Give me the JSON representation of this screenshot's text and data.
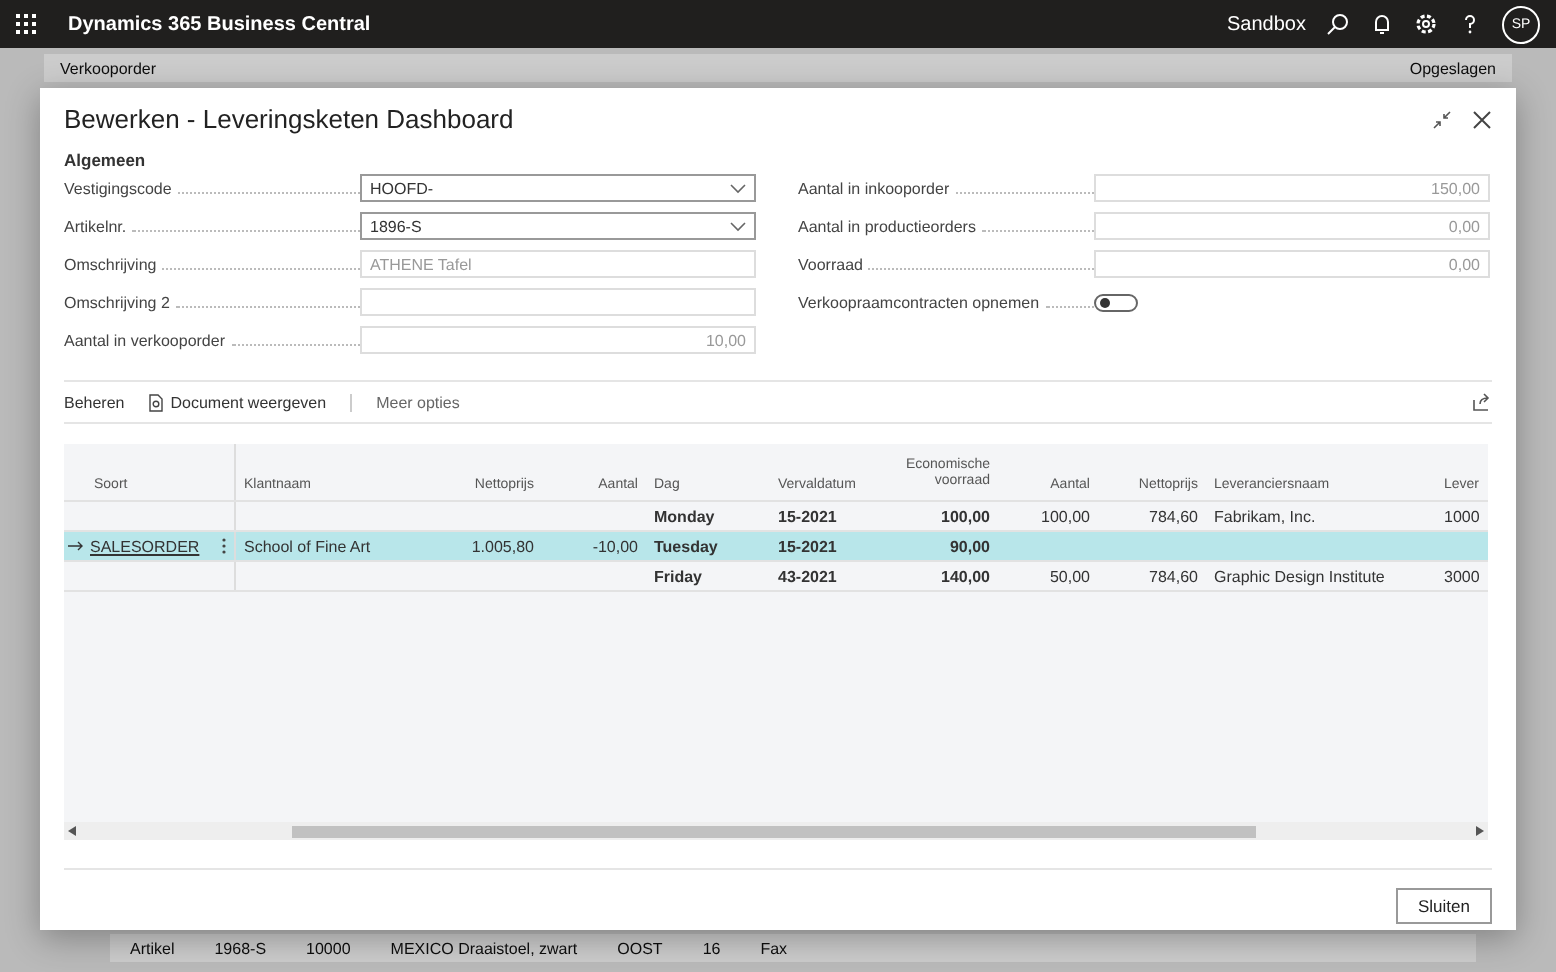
{
  "top_bar": {
    "app_title": "Dynamics 365 Business Central",
    "environment": "Sandbox",
    "avatar": "SP"
  },
  "background_page": {
    "title": "Verkooporder",
    "save_status": "Opgeslagen",
    "rows": [
      [
        "Artikel",
        "1968-S",
        "10000",
        "MEXICO Draaistoel, zwart",
        "OOST",
        "16",
        "Fax"
      ]
    ]
  },
  "dialog": {
    "title": "Bewerken - Leveringsketen Dashboard",
    "section": "Algemeen",
    "left_fields": [
      {
        "label": "Vestigingscode",
        "kind": "dropdown",
        "value": "HOOFD-",
        "disabled": false
      },
      {
        "label": "Artikelnr.",
        "kind": "dropdown",
        "value": "1896-S",
        "disabled": false
      },
      {
        "label": "Omschrijving",
        "kind": "text",
        "value": "ATHENE Tafel",
        "disabled": true
      },
      {
        "label": "Omschrijving 2",
        "kind": "text",
        "disabled": true
      },
      {
        "label": "Aantal in verkooporder",
        "kind": "number",
        "value": "10,00",
        "disabled": true
      }
    ],
    "right_fields": [
      {
        "label": "Aantal in inkooporder",
        "kind": "number",
        "value": "150,00",
        "disabled": true
      },
      {
        "label": "Aantal in productieorders",
        "kind": "number",
        "value": "0,00",
        "disabled": true
      },
      {
        "label": "Voorraad",
        "kind": "number",
        "value": "0,00",
        "disabled": true
      },
      {
        "label": "Verkoopraamcontracten opnemen",
        "kind": "toggle",
        "on": false
      }
    ],
    "actions": [
      {
        "label": "Beheren",
        "kind": "plain"
      },
      {
        "label": "Document weergeven",
        "kind": "icon"
      },
      {
        "label": "Meer opties",
        "kind": "more"
      }
    ],
    "table": {
      "columns": [
        "Soort",
        "Klantnaam",
        "Nettoprijs",
        "Aantal",
        "Dag",
        "Vervaldatum",
        "Economische voorraad",
        "Aantal",
        "Nettoprijs",
        "Leveranciersnaam",
        "Lever"
      ],
      "rows": [
        {
          "selected": false,
          "cells": [
            null,
            null,
            null,
            null,
            "Monday",
            "15-2021",
            "100,00",
            "100,00",
            "784,60",
            "Fabrikam, Inc.",
            "1000"
          ]
        },
        {
          "selected": true,
          "cells": [
            "SALESORDER",
            "School of Fine Art",
            "1.005,80",
            "-10,00",
            "Tuesday",
            "15-2021",
            "90,00",
            null,
            null,
            null,
            null
          ]
        },
        {
          "selected": false,
          "cells": [
            null,
            null,
            null,
            null,
            "Friday",
            "43-2021",
            "140,00",
            "50,00",
            "784,60",
            "Graphic Design Institute",
            "3000"
          ]
        }
      ]
    },
    "close_button": "Sluiten"
  }
}
